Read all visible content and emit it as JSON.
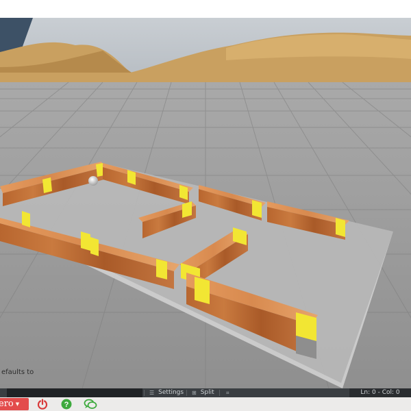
{
  "console": {
    "text": "efaults to"
  },
  "status_bar": {
    "settings_label": "Settings",
    "split_label": "Split",
    "settings_icon": "list-icon",
    "split_icon": "split-icon",
    "extra_icon": "grid-icon",
    "cursor_position": "Ln: 0 - Col: 0"
  },
  "bottom_toolbar": {
    "run_label": "ero",
    "run_button_color": "#e34c4c",
    "icons": [
      "power-icon",
      "help-icon",
      "chat-icon"
    ],
    "power_color": "#d93a3a",
    "help_color": "#3daa3d",
    "chat_color": "#3daa3d"
  },
  "scene": {
    "description_colors": {
      "sky": "#bfc6cc",
      "ground": "#9c9c9c",
      "wall": "#c4763f",
      "wall_stripe": "#f2e633",
      "board": "#b5b5b5"
    }
  }
}
